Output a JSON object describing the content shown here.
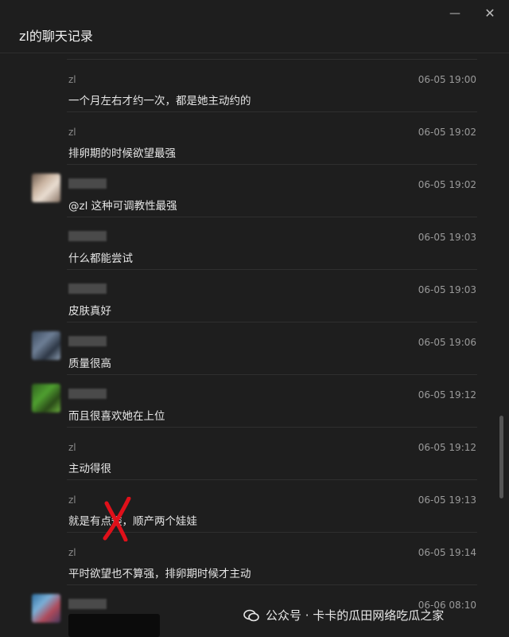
{
  "window": {
    "title": "zl的聊天记录",
    "minimize_glyph": "—",
    "close_glyph": "✕"
  },
  "messages": [
    {
      "sender": "zl",
      "time": "06-05 19:00",
      "text": "一个月左右才约一次，都是她主动约的",
      "avatar": "none",
      "sender_visible": true
    },
    {
      "sender": "zl",
      "time": "06-05 19:02",
      "text": "排卵期的时候欲望最强",
      "avatar": "none",
      "sender_visible": true
    },
    {
      "sender": "",
      "time": "06-05 19:02",
      "text": "@zl 这种可调教性最强",
      "avatar": "beige",
      "sender_visible": false
    },
    {
      "sender": "",
      "time": "06-05 19:03",
      "text": "什么都能尝试",
      "avatar": "none",
      "sender_visible": false
    },
    {
      "sender": "",
      "time": "06-05 19:03",
      "text": "皮肤真好",
      "avatar": "none",
      "sender_visible": false
    },
    {
      "sender": "",
      "time": "06-05 19:06",
      "text": "质量很高",
      "avatar": "blue-gray",
      "sender_visible": false
    },
    {
      "sender": "",
      "time": "06-05 19:12",
      "text": "而且很喜欢她在上位",
      "avatar": "green",
      "sender_visible": false
    },
    {
      "sender": "zl",
      "time": "06-05 19:12",
      "text": "主动得很",
      "avatar": "none",
      "sender_visible": true
    },
    {
      "sender": "zl",
      "time": "06-05 19:13",
      "text": "就是有点矮，顺产两个娃娃",
      "avatar": "none",
      "sender_visible": true
    },
    {
      "sender": "zl",
      "time": "06-05 19:14",
      "text": "平时欲望也不算强，排卵期时候才主动",
      "avatar": "none",
      "sender_visible": true
    },
    {
      "sender": "",
      "time": "06-06 08:10",
      "text": "",
      "avatar": "colorful",
      "sender_visible": false
    }
  ],
  "watermark": {
    "text": "公众号 · 卡卡的瓜田网络吃瓜之家",
    "icon": "wechat-icon"
  },
  "colors": {
    "background": "#1e1e1e",
    "divider": "#2f2f2f",
    "annotation": "#e0101a"
  }
}
